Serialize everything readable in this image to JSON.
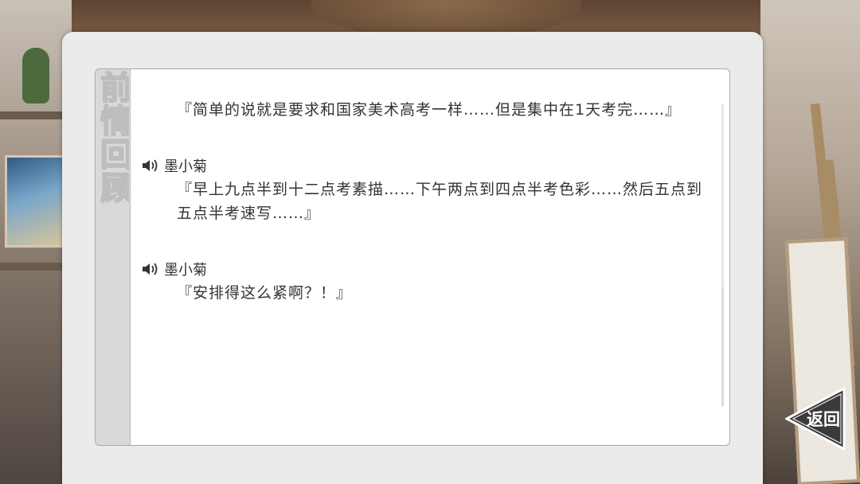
{
  "panel": {
    "side_title": "前情回顾"
  },
  "log": [
    {
      "speaker": "",
      "has_voice": false,
      "text": "『简单的说就是要求和国家美术高考一样……但是集中在1天考完……』"
    },
    {
      "speaker": "墨小菊",
      "has_voice": true,
      "text": "『早上九点半到十二点考素描……下午两点到四点半考色彩……然后五点到五点半考速写……』"
    },
    {
      "speaker": "墨小菊",
      "has_voice": true,
      "text": "『安排得这么紧啊？！』"
    }
  ],
  "buttons": {
    "back_label": "返回"
  },
  "icons": {
    "voice": "speaker-icon",
    "back": "back-arrow-icon"
  },
  "colors": {
    "panel_bg": "#ebebeb",
    "text": "#333333",
    "back_button": "#3a3a3a"
  }
}
